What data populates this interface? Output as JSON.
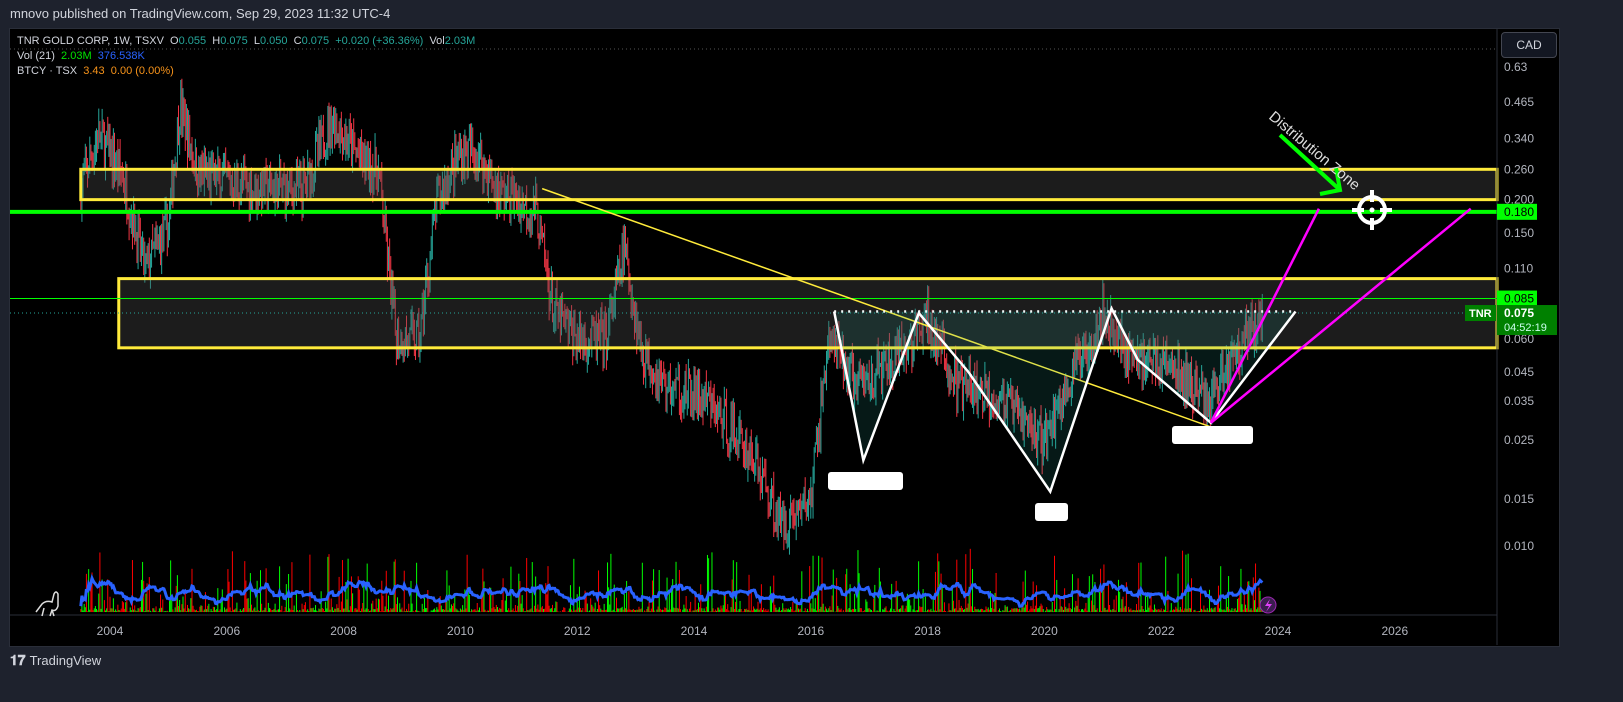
{
  "header": {
    "published": "mnovo published on TradingView.com, Sep 29, 2023 11:32 UTC-4"
  },
  "legend": {
    "symbol": "TNR GOLD CORP, 1W, TSXV",
    "o_label": "O",
    "o": "0.055",
    "h_label": "H",
    "h": "0.075",
    "l_label": "L",
    "l": "0.050",
    "c_label": "C",
    "c": "0.075",
    "change": "+0.020 (+36.36%)",
    "vol_label": "Vol",
    "vol": "2.03M",
    "vol_ind": "Vol (21)",
    "vol_ind_v1": "2.03M",
    "vol_ind_v2": "376.538K",
    "compare": "BTCY · TSX",
    "compare_price": "3.43",
    "compare_change": "0.00 (0.00%)"
  },
  "currency_button": "CAD",
  "price_axis": [
    "0.63",
    "0.465",
    "0.340",
    "0.260",
    "0.200",
    "0.150",
    "0.110",
    "0.085",
    "0.060",
    "0.045",
    "0.035",
    "0.025",
    "0.015",
    "0.010"
  ],
  "price_labels": {
    "green_line": "0.180",
    "thin_green": "0.085",
    "last": "0.075",
    "countdown": "04:52:19",
    "ticker": "TNR"
  },
  "time_axis": [
    "2004",
    "2006",
    "2008",
    "2010",
    "2012",
    "2014",
    "2016",
    "2018",
    "2020",
    "2022",
    "2024",
    "2026"
  ],
  "annotation": "Distribution Zone",
  "footer": "TradingView",
  "colors": {
    "up": "#26a69a",
    "down": "#f23645",
    "zone": "#ffeb3b",
    "green_line": "#00ff00",
    "magenta": "#ff00ff",
    "vol_ma": "#2962ff"
  },
  "chart_data": {
    "type": "candlestick",
    "scale": "log",
    "symbol": "TNR",
    "timeframe": "1W",
    "ylim": [
      0.007,
      0.7
    ],
    "xlim": [
      2002.6,
      2027.4
    ],
    "price_path": [
      [
        2003.5,
        0.22
      ],
      [
        2003.8,
        0.35
      ],
      [
        2004.2,
        0.25
      ],
      [
        2004.6,
        0.11
      ],
      [
        2005.0,
        0.16
      ],
      [
        2005.2,
        0.45
      ],
      [
        2005.5,
        0.25
      ],
      [
        2006.5,
        0.22
      ],
      [
        2007.3,
        0.22
      ],
      [
        2007.8,
        0.4
      ],
      [
        2008.2,
        0.3
      ],
      [
        2008.6,
        0.25
      ],
      [
        2008.9,
        0.06
      ],
      [
        2009.3,
        0.06
      ],
      [
        2009.6,
        0.2
      ],
      [
        2010.0,
        0.3
      ],
      [
        2010.3,
        0.3
      ],
      [
        2010.6,
        0.22
      ],
      [
        2011.3,
        0.18
      ],
      [
        2011.6,
        0.075
      ],
      [
        2012.0,
        0.06
      ],
      [
        2012.5,
        0.06
      ],
      [
        2012.8,
        0.13
      ],
      [
        2013.1,
        0.055
      ],
      [
        2013.5,
        0.04
      ],
      [
        2014.2,
        0.035
      ],
      [
        2015.0,
        0.022
      ],
      [
        2015.5,
        0.012
      ],
      [
        2016.0,
        0.015
      ],
      [
        2016.3,
        0.06
      ],
      [
        2016.8,
        0.04
      ],
      [
        2017.5,
        0.05
      ],
      [
        2018.0,
        0.07
      ],
      [
        2018.5,
        0.04
      ],
      [
        2019.3,
        0.035
      ],
      [
        2020.0,
        0.025
      ],
      [
        2020.5,
        0.045
      ],
      [
        2021.0,
        0.075
      ],
      [
        2021.5,
        0.05
      ],
      [
        2022.0,
        0.05
      ],
      [
        2022.8,
        0.035
      ],
      [
        2023.3,
        0.055
      ],
      [
        2023.74,
        0.075
      ]
    ],
    "zones": [
      {
        "from": 2003.5,
        "low": 0.2,
        "high": 0.26
      },
      {
        "from": 2004.15,
        "low": 0.0555,
        "high": 0.101
      }
    ],
    "hlines": [
      {
        "price": 0.18,
        "style": "thick-green"
      },
      {
        "price": 0.085,
        "style": "thin-green"
      }
    ],
    "trendline": [
      [
        2011.4,
        0.22
      ],
      [
        2022.85,
        0.028
      ]
    ],
    "neckline": {
      "from": 2016.4,
      "to": 2024.3,
      "price": 0.076
    },
    "pattern": [
      [
        2016.4,
        0.076
      ],
      [
        2016.9,
        0.021
      ],
      [
        2017.85,
        0.075
      ],
      [
        2018.7,
        0.045
      ],
      [
        2020.1,
        0.016
      ],
      [
        2021.15,
        0.078
      ],
      [
        2021.6,
        0.05
      ],
      [
        2022.85,
        0.029
      ],
      [
        2024.3,
        0.076
      ]
    ],
    "projections": [
      [
        [
          2022.85,
          0.029
        ],
        [
          2024.7,
          0.185
        ]
      ],
      [
        [
          2022.85,
          0.029
        ],
        [
          2027.3,
          0.185
        ]
      ]
    ],
    "target": [
      2026.0,
      0.18
    ]
  }
}
